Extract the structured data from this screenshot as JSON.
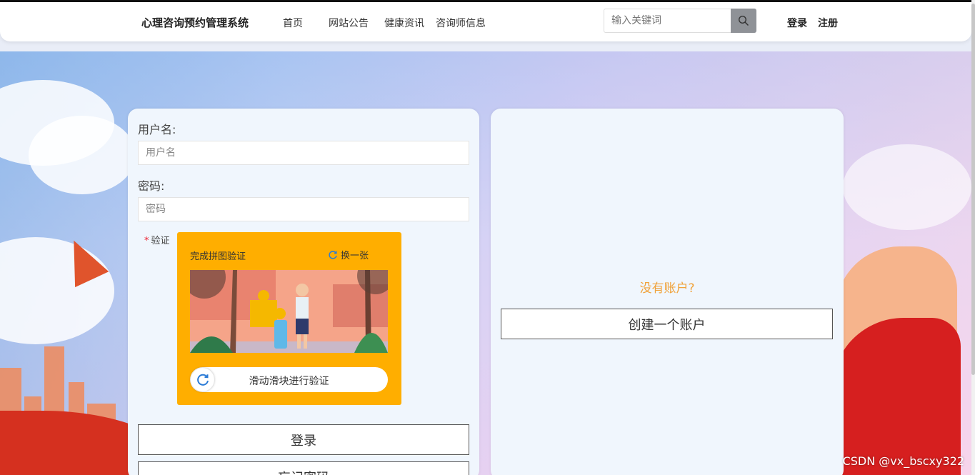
{
  "header": {
    "brand": "心理咨询预约管理系统",
    "nav": [
      "首页",
      "网站公告",
      "健康资讯",
      "咨询师信息"
    ],
    "search_placeholder": "输入关键词",
    "login": "登录",
    "register": "注册"
  },
  "login_form": {
    "username_label": "用户名:",
    "username_placeholder": "用户名",
    "password_label": "密码:",
    "password_placeholder": "密码",
    "verify_label": "验证",
    "captcha": {
      "title": "完成拼图验证",
      "refresh": "换一张",
      "slider_hint": "滑动滑块进行验证"
    },
    "login_button": "登录",
    "forgot_button": "忘记密码"
  },
  "signup_panel": {
    "prompt": "没有账户?",
    "create_button": "创建一个账户"
  },
  "watermark": "CSDN @vx_bscxy322",
  "colors": {
    "captcha_bg": "#ffae00",
    "prompt": "#f0a23a",
    "panel_bg": "#f0f6fd"
  }
}
